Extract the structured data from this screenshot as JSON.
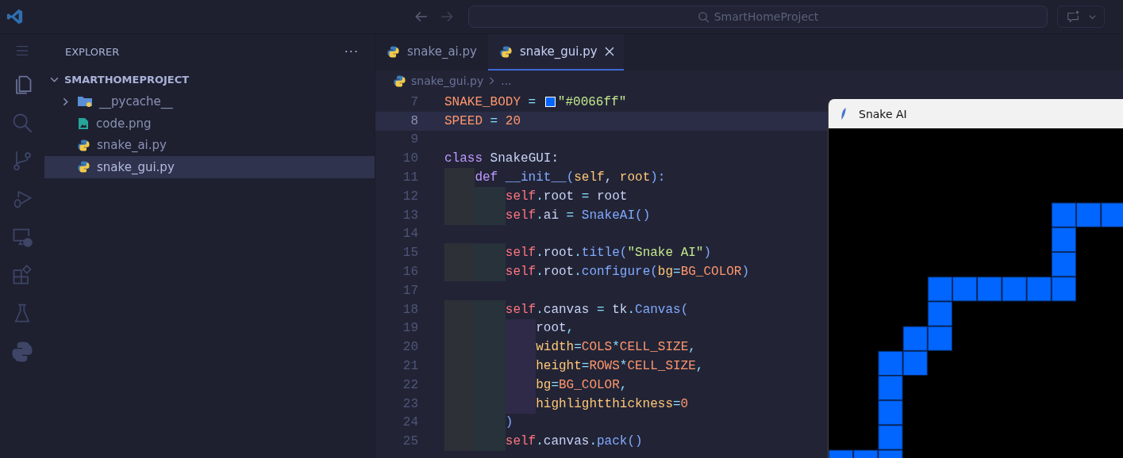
{
  "title_bar": {
    "search": "SmartHomeProject"
  },
  "sidebar": {
    "title": "EXPLORER",
    "more": "···",
    "tree": [
      {
        "label": "SMARTHOMEPROJECT",
        "kind": "root",
        "expanded": true,
        "selected": false,
        "children": [
          {
            "label": "__pycache__",
            "kind": "folder",
            "expanded": false,
            "selected": false
          },
          {
            "label": "code.png",
            "kind": "image",
            "selected": false
          },
          {
            "label": "snake_ai.py",
            "kind": "python",
            "selected": false
          },
          {
            "label": "snake_gui.py",
            "kind": "python",
            "selected": true
          }
        ]
      }
    ]
  },
  "tabs": [
    {
      "label": "snake_ai.py",
      "selected": false
    },
    {
      "label": "snake_gui.py",
      "selected": true
    }
  ],
  "breadcrumbs": [
    "snake_gui.py",
    "..."
  ],
  "editor": {
    "lines": [
      {
        "number": "7",
        "current": false,
        "tokens": [
          {
            "text": "SNAKE_BODY",
            "kind": "const"
          },
          {
            "text": " = ",
            "kind": "op"
          },
          {
            "kind": "swatch",
            "color": "#0066ff"
          },
          {
            "text": "\"#0066ff\"",
            "kind": "str"
          }
        ]
      },
      {
        "number": "8",
        "current": true,
        "tokens": [
          {
            "text": "SPEED",
            "kind": "const"
          },
          {
            "text": " = ",
            "kind": "op"
          },
          {
            "text": "20",
            "kind": "num"
          }
        ]
      },
      {
        "number": "9",
        "current": false
      },
      {
        "number": "10",
        "current": false,
        "tokens": [
          {
            "text": "class",
            "kind": "kw"
          },
          {
            "text": " SnakeGUI:",
            "kind": "plain"
          }
        ]
      },
      {
        "number": "11",
        "current": false,
        "tokens": [
          {
            "text": "    def",
            "kind": "kw"
          },
          {
            "text": " __init__",
            "kind": "fn"
          },
          {
            "text": "(",
            "kind": "punct"
          },
          {
            "text": "self",
            "kind": "param"
          },
          {
            "text": ", ",
            "kind": "plain"
          },
          {
            "text": "root",
            "kind": "param"
          },
          {
            "text": "):",
            "kind": "punct"
          }
        ]
      },
      {
        "number": "12",
        "current": false,
        "tokens": [
          {
            "text": "        self",
            "kind": "self"
          },
          {
            "text": ".",
            "kind": "op"
          },
          {
            "text": "root",
            "kind": "plain"
          },
          {
            "text": " = ",
            "kind": "op"
          },
          {
            "text": "root",
            "kind": "plain"
          }
        ]
      },
      {
        "number": "13",
        "current": false,
        "tokens": [
          {
            "text": "        self",
            "kind": "self"
          },
          {
            "text": ".",
            "kind": "op"
          },
          {
            "text": "ai",
            "kind": "plain"
          },
          {
            "text": " = ",
            "kind": "op"
          },
          {
            "text": "SnakeAI",
            "kind": "fn"
          },
          {
            "text": "()",
            "kind": "punct"
          }
        ]
      },
      {
        "number": "14",
        "current": false
      },
      {
        "number": "15",
        "current": false,
        "tokens": [
          {
            "text": "        self",
            "kind": "self"
          },
          {
            "text": ".",
            "kind": "op"
          },
          {
            "text": "root",
            "kind": "plain"
          },
          {
            "text": ".",
            "kind": "op"
          },
          {
            "text": "title",
            "kind": "fn"
          },
          {
            "text": "(",
            "kind": "punct"
          },
          {
            "text": "\"Snake AI\"",
            "kind": "str"
          },
          {
            "text": ")",
            "kind": "punct"
          }
        ]
      },
      {
        "number": "16",
        "current": false,
        "tokens": [
          {
            "text": "        self",
            "kind": "self"
          },
          {
            "text": ".",
            "kind": "op"
          },
          {
            "text": "root",
            "kind": "plain"
          },
          {
            "text": ".",
            "kind": "op"
          },
          {
            "text": "configure",
            "kind": "fn"
          },
          {
            "text": "(",
            "kind": "punct"
          },
          {
            "text": "bg",
            "kind": "param"
          },
          {
            "text": "=",
            "kind": "op"
          },
          {
            "text": "BG_COLOR",
            "kind": "const"
          },
          {
            "text": ")",
            "kind": "punct"
          }
        ]
      },
      {
        "number": "17",
        "current": false
      },
      {
        "number": "18",
        "current": false,
        "tokens": [
          {
            "text": "        self",
            "kind": "self"
          },
          {
            "text": ".",
            "kind": "op"
          },
          {
            "text": "canvas",
            "kind": "plain"
          },
          {
            "text": " = ",
            "kind": "op"
          },
          {
            "text": "tk",
            "kind": "plain"
          },
          {
            "text": ".",
            "kind": "op"
          },
          {
            "text": "Canvas",
            "kind": "fn"
          },
          {
            "text": "(",
            "kind": "punct"
          }
        ]
      },
      {
        "number": "19",
        "current": false,
        "tokens": [
          {
            "text": "            root",
            "kind": "plain"
          },
          {
            "text": ",",
            "kind": "op"
          }
        ]
      },
      {
        "number": "20",
        "current": false,
        "tokens": [
          {
            "text": "            width",
            "kind": "param"
          },
          {
            "text": "=",
            "kind": "op"
          },
          {
            "text": "COLS",
            "kind": "const"
          },
          {
            "text": "*",
            "kind": "op"
          },
          {
            "text": "CELL_SIZE",
            "kind": "const"
          },
          {
            "text": ",",
            "kind": "op"
          }
        ]
      },
      {
        "number": "21",
        "current": false,
        "tokens": [
          {
            "text": "            height",
            "kind": "param"
          },
          {
            "text": "=",
            "kind": "op"
          },
          {
            "text": "ROWS",
            "kind": "const"
          },
          {
            "text": "*",
            "kind": "op"
          },
          {
            "text": "CELL_SIZE",
            "kind": "const"
          },
          {
            "text": ",",
            "kind": "op"
          }
        ]
      },
      {
        "number": "22",
        "current": false,
        "tokens": [
          {
            "text": "            bg",
            "kind": "param"
          },
          {
            "text": "=",
            "kind": "op"
          },
          {
            "text": "BG_COLOR",
            "kind": "const"
          },
          {
            "text": ",",
            "kind": "op"
          }
        ]
      },
      {
        "number": "23",
        "current": false,
        "tokens": [
          {
            "text": "            highlightthickness",
            "kind": "param"
          },
          {
            "text": "=",
            "kind": "op"
          },
          {
            "text": "0",
            "kind": "num"
          }
        ]
      },
      {
        "number": "24",
        "current": false,
        "tokens": [
          {
            "text": "        )",
            "kind": "punct"
          }
        ]
      },
      {
        "number": "25",
        "current": false,
        "tokens": [
          {
            "text": "        self",
            "kind": "self"
          },
          {
            "text": ".",
            "kind": "op"
          },
          {
            "text": "canvas",
            "kind": "plain"
          },
          {
            "text": ".",
            "kind": "op"
          },
          {
            "text": "pack",
            "kind": "fn"
          },
          {
            "text": "()",
            "kind": "punct"
          }
        ]
      }
    ]
  },
  "snake_window": {
    "title": "Snake AI"
  }
}
